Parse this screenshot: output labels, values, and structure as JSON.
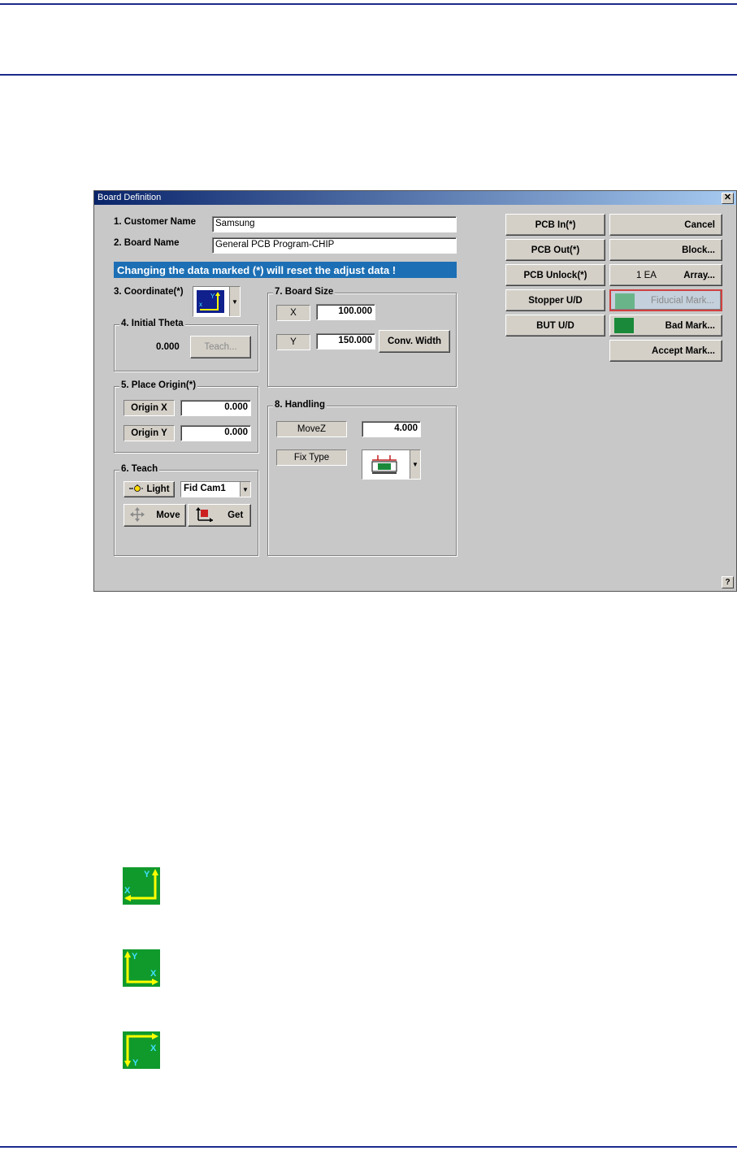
{
  "dialog": {
    "title": "Board Definition",
    "close_glyph": "✕",
    "help_glyph": "?",
    "customer_label": "1. Customer Name",
    "customer_value": "Samsung",
    "board_label": "2. Board Name",
    "board_value": "General PCB Program-CHIP",
    "warning": "Changing the data marked (*) will reset the adjust data !",
    "coordinate_label": "3. Coordinate(*)",
    "initial_theta": {
      "label": "4. Initial Theta",
      "value": "0.000",
      "teach_button": "Teach..."
    },
    "place_origin": {
      "label": "5. Place Origin(*)",
      "origin_x_label": "Origin X",
      "origin_x_value": "0.000",
      "origin_y_label": "Origin Y",
      "origin_y_value": "0.000"
    },
    "teach": {
      "label": "6. Teach",
      "light_button": "Light",
      "camera_select": "Fid Cam1",
      "move_button": "Move",
      "get_button": "Get"
    },
    "board_size": {
      "label": "7. Board Size",
      "x_label": "X",
      "x_value": "100.000",
      "y_label": "Y",
      "y_value": "150.000",
      "conv_width_button": "Conv. Width"
    },
    "handling": {
      "label": "8. Handling",
      "movez_label": "MoveZ",
      "movez_value": "4.000",
      "fix_type_label": "Fix Type"
    },
    "buttons": {
      "pcb_in": "PCB In(*)",
      "pcb_out": "PCB Out(*)",
      "pcb_unlock": "PCB Unlock(*)",
      "stopper": "Stopper U/D",
      "but": "BUT U/D",
      "cancel": "Cancel",
      "block": "Block...",
      "array_count": "1 EA",
      "array": "Array...",
      "fiducial": "Fiducial Mark...",
      "bad_mark": "Bad Mark...",
      "accept_mark": "Accept Mark..."
    }
  },
  "coordinate_icons": [
    {
      "name": "origin-bottom-right",
      "x": "X",
      "y": "Y"
    },
    {
      "name": "origin-bottom-left",
      "x": "X",
      "y": "Y"
    },
    {
      "name": "origin-top-left",
      "x": "X",
      "y": "Y"
    }
  ],
  "colors": {
    "rule": "#1c2a8c",
    "banner": "#1c6fb4",
    "icon_green": "#109a2c",
    "icon_yellow": "#ffff00",
    "icon_cyan": "#40e0ff"
  }
}
